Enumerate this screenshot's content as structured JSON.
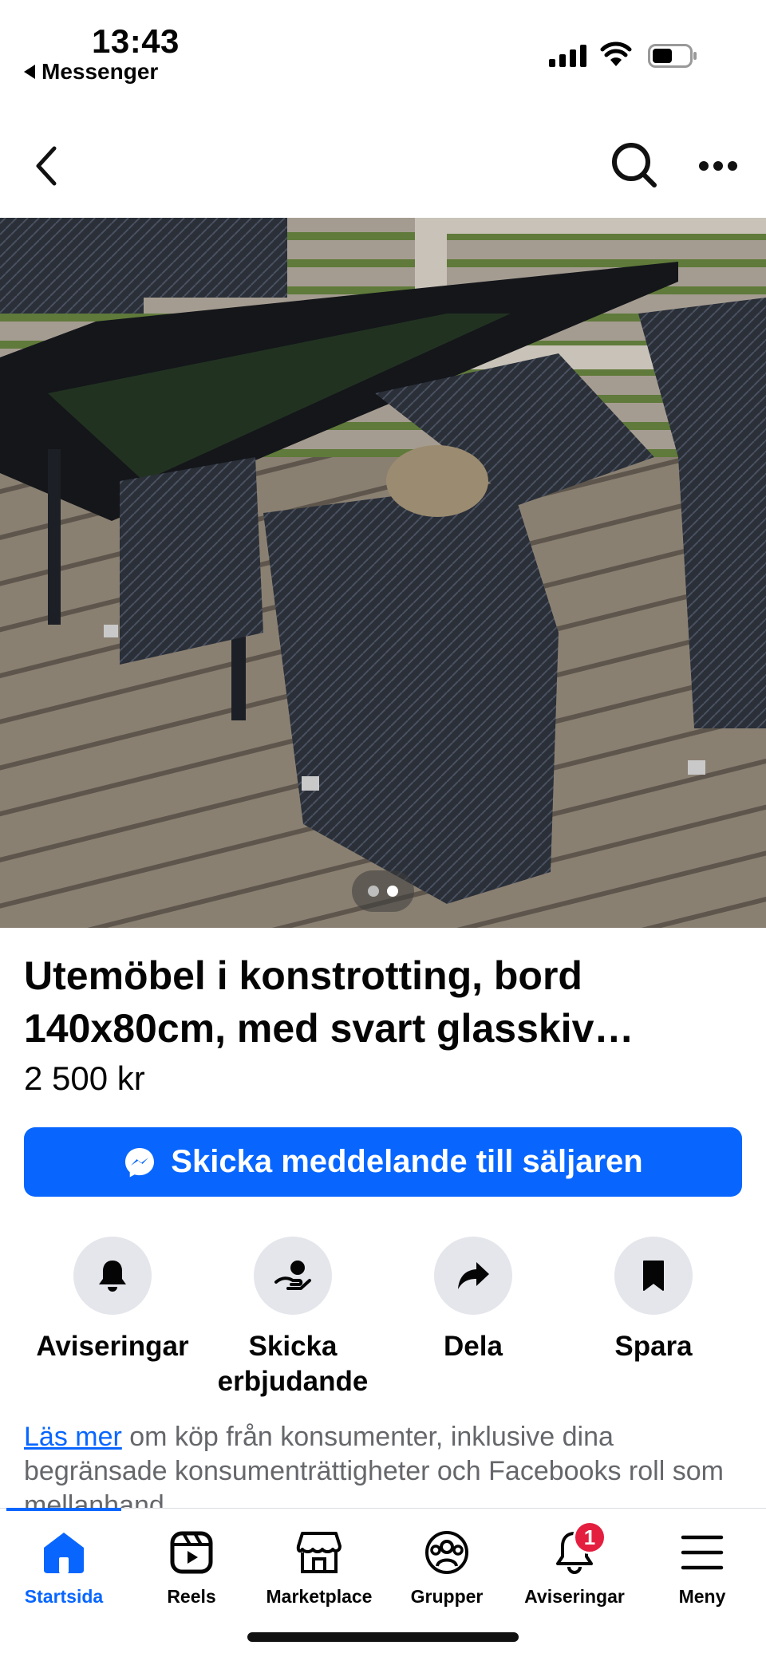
{
  "status_bar": {
    "time": "13:43",
    "back_app": "Messenger"
  },
  "listing": {
    "title": "Utemöbel i konstrotting, bord 140x80cm, med svart glasskiv…",
    "price": "2 500 kr",
    "photo_count": 2,
    "photo_index": 1
  },
  "message_button": {
    "label": "Skicka meddelande till säljaren"
  },
  "actions": [
    {
      "label": "Aviseringar",
      "icon": "bell-icon"
    },
    {
      "label": "Skicka erbjudande",
      "icon": "offer-hand-icon"
    },
    {
      "label": "Dela",
      "icon": "share-arrow-icon"
    },
    {
      "label": "Spara",
      "icon": "bookmark-icon"
    }
  ],
  "disclaimer": {
    "link": "Läs mer",
    "text": " om köp från konsumenter, inklusive dina begränsade konsumenträttigheter och Facebooks roll som mellanhand."
  },
  "tabs": [
    {
      "label": "Startsida",
      "icon": "home-icon",
      "active": true
    },
    {
      "label": "Reels",
      "icon": "reels-icon"
    },
    {
      "label": "Marketplace",
      "icon": "marketplace-icon"
    },
    {
      "label": "Grupper",
      "icon": "groups-icon"
    },
    {
      "label": "Aviseringar",
      "icon": "bell-icon",
      "badge": "1"
    },
    {
      "label": "Meny",
      "icon": "menu-icon"
    }
  ],
  "colors": {
    "accent": "#0866ff",
    "badge": "#e41e3f",
    "action_bg": "#e4e6eb",
    "secondary_text": "#65676b"
  }
}
